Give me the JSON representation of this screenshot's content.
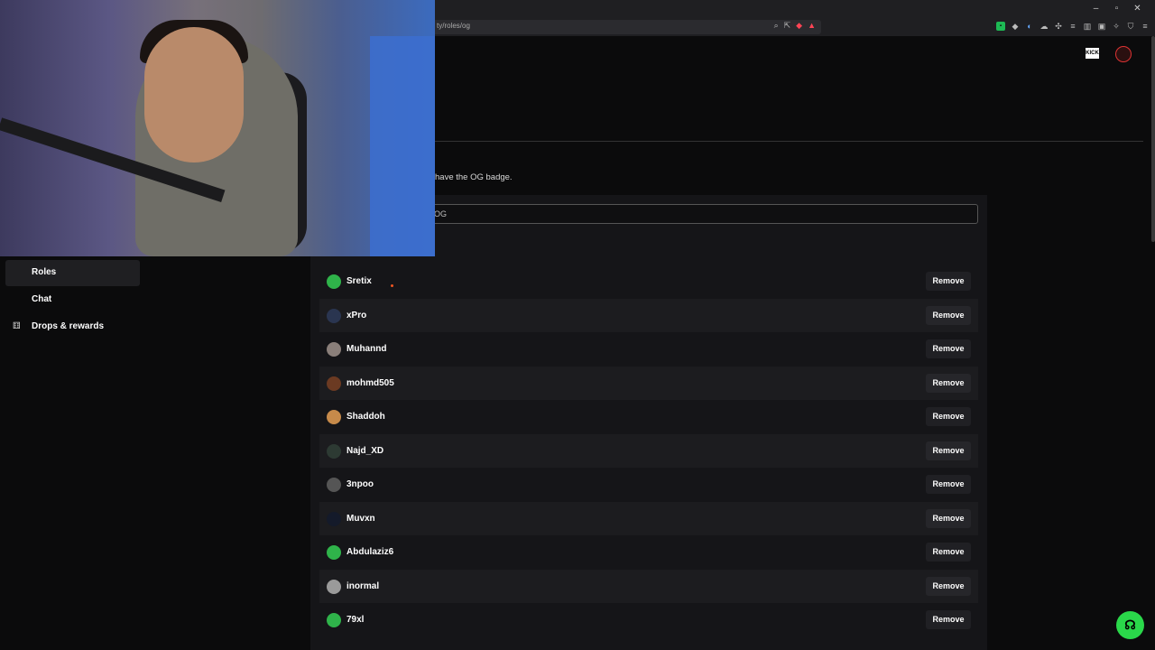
{
  "browser": {
    "url": "ty/roles/og",
    "window_buttons": [
      "–",
      "▫",
      "✕"
    ]
  },
  "page": {
    "description": "have the OG badge.",
    "search_value": "OG"
  },
  "sidebar": {
    "items": [
      {
        "label": "Roles",
        "icon": "",
        "active": true
      },
      {
        "label": "Chat",
        "icon": "",
        "active": false
      },
      {
        "label": "Drops & rewards",
        "icon": "gift-icon",
        "active": false
      }
    ]
  },
  "members": [
    {
      "name": "Sretix",
      "avatar_color": "#2fb34a",
      "action": "Remove"
    },
    {
      "name": "xPro",
      "avatar_color": "#2a3550",
      "action": "Remove"
    },
    {
      "name": "Muhannd",
      "avatar_color": "#8a7f7a",
      "action": "Remove"
    },
    {
      "name": "mohmd505",
      "avatar_color": "#6b3a22",
      "action": "Remove"
    },
    {
      "name": "Shaddoh",
      "avatar_color": "#c68a4a",
      "action": "Remove"
    },
    {
      "name": "Najd_XD",
      "avatar_color": "#2d3a33",
      "action": "Remove"
    },
    {
      "name": "3npoo",
      "avatar_color": "#555555",
      "action": "Remove"
    },
    {
      "name": "Muvxn",
      "avatar_color": "#141a2a",
      "action": "Remove"
    },
    {
      "name": "Abdulaziz6",
      "avatar_color": "#2fb34a",
      "action": "Remove"
    },
    {
      "name": "inormal",
      "avatar_color": "#9a9a9a",
      "action": "Remove"
    },
    {
      "name": "79xl",
      "avatar_color": "#2fb34a",
      "action": "Remove"
    }
  ],
  "icons": {
    "logo": "KICK",
    "help": "headset-icon"
  },
  "colors": {
    "accent": "#2ad84a",
    "background": "#0b0b0c"
  }
}
